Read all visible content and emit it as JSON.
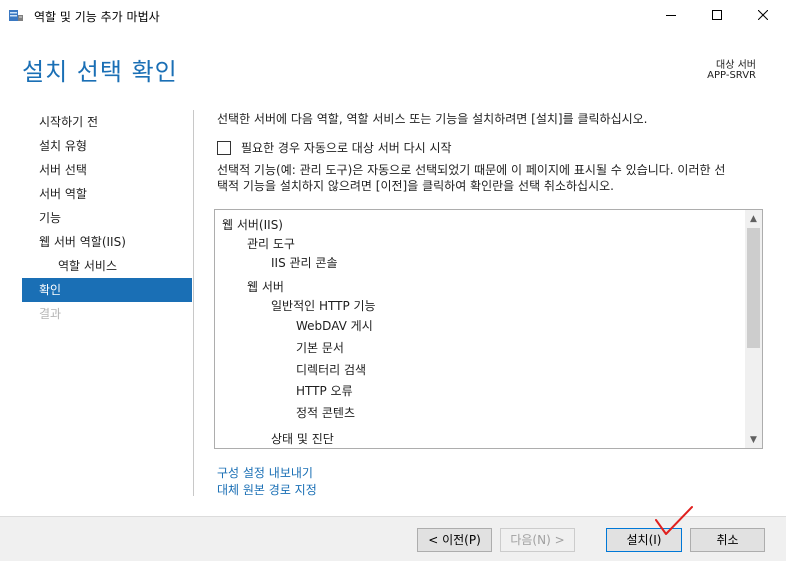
{
  "window": {
    "title": "역할 및 기능 추가 마법사"
  },
  "header": {
    "page_title": "설치 선택 확인",
    "target_label": "대상 서버",
    "target_server": "APP-SRVR"
  },
  "nav": {
    "items": [
      {
        "label": "시작하기 전"
      },
      {
        "label": "설치 유형"
      },
      {
        "label": "서버 선택"
      },
      {
        "label": "서버 역할"
      },
      {
        "label": "기능"
      },
      {
        "label": "웹 서버 역할(IIS)"
      },
      {
        "label": "역할 서비스"
      },
      {
        "label": "확인"
      },
      {
        "label": "결과"
      }
    ]
  },
  "main": {
    "intro": "선택한 서버에 다음 역할, 역할 서비스 또는 기능을 설치하려면 [설치]를 클릭하십시오.",
    "restart_checkbox": {
      "label": "필요한 경우 자동으로 대상 서버 다시 시작",
      "checked": false
    },
    "note_line1": "선택적 기능(예: 관리 도구)은 자동으로 선택되었기 때문에 이 페이지에 표시될 수 있습니다. 이러한 선",
    "note_line2": "택적 기능을 설치하지 않으려면 [이전]을 클릭하여 확인란을 선택 취소하십시오.",
    "tree": [
      {
        "label": "웹 서버(IIS)"
      },
      {
        "label": "관리 도구"
      },
      {
        "label": "IIS 관리 콘솔"
      },
      {
        "label": "웹 서버"
      },
      {
        "label": "일반적인 HTTP 기능"
      },
      {
        "label": "WebDAV 게시"
      },
      {
        "label": "기본 문서"
      },
      {
        "label": "디렉터리 검색"
      },
      {
        "label": "HTTP 오류"
      },
      {
        "label": "정적 콘텐츠"
      },
      {
        "label": "상태 및 진단"
      }
    ],
    "links": {
      "export": "구성 설정 내보내기",
      "alternate_source": "대체 원본 경로 지정"
    }
  },
  "footer": {
    "previous": "< 이전(P)",
    "next": "다음(N) >",
    "install": "설치(I)",
    "cancel": "취소"
  },
  "colors": {
    "accent": "#1a6fb5",
    "annotation": "#e0201e"
  }
}
